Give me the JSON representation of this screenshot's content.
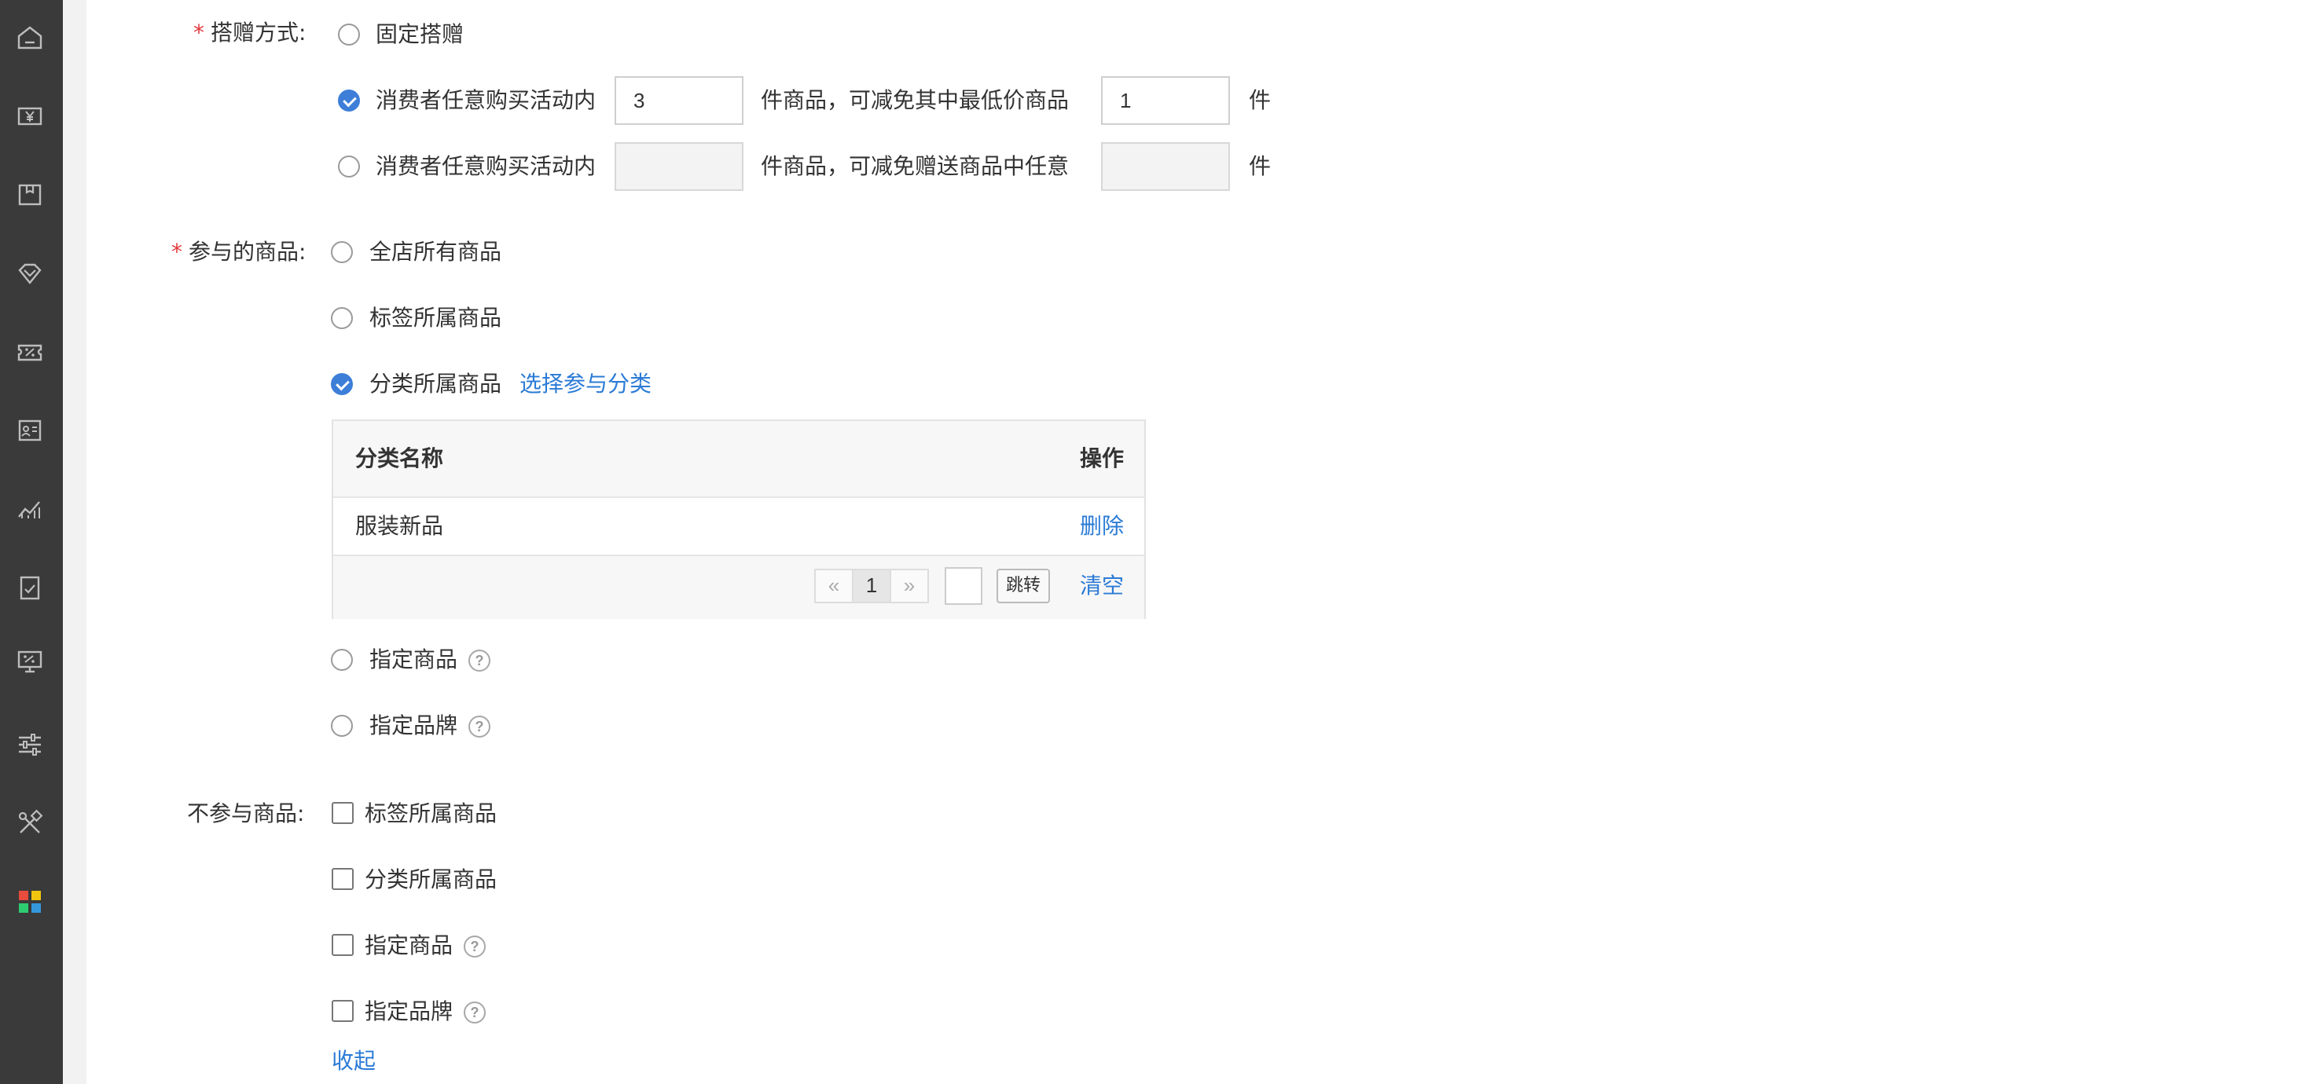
{
  "sidebar": {
    "icons": [
      "home-icon",
      "yen-icon",
      "box-icon",
      "diamond-icon",
      "coupon-icon",
      "member-card-icon",
      "chart-icon",
      "clipboard-icon",
      "monitor-icon",
      "sliders-icon",
      "tools-icon",
      "apps-icon"
    ],
    "apps_colors": [
      "#e74c3c",
      "#f1c40f",
      "#2ecc71",
      "#3498db"
    ]
  },
  "gift_method": {
    "label": "搭赠方式:",
    "option_fixed": "固定搭赠",
    "option_any_prefix": "消费者任意购买活动内",
    "option_any_qty": "3",
    "option_any_mid": "件商品，可减免其中最低价商品",
    "option_any_free": "1",
    "option_any_suffix": "件",
    "option_gift_prefix": "消费者任意购买活动内",
    "option_gift_qty": "",
    "option_gift_mid": "件商品，可减免赠送商品中任意",
    "option_gift_free": "",
    "option_gift_suffix": "件"
  },
  "participating": {
    "label": "参与的商品:",
    "option_all": "全店所有商品",
    "option_tag": "标签所属商品",
    "option_category": "分类所属商品",
    "choose_category_link": "选择参与分类",
    "table": {
      "col_name": "分类名称",
      "col_action": "操作",
      "rows": [
        {
          "name": "服装新品",
          "action": "删除"
        }
      ],
      "pager": {
        "prev": "«",
        "current": "1",
        "next": "»",
        "jump_value": "",
        "jump_label": "跳转",
        "clear": "清空"
      }
    },
    "option_specified": "指定商品",
    "option_brand": "指定品牌",
    "help_glyph": "?"
  },
  "excluded": {
    "label": "不参与商品:",
    "option_tag": "标签所属商品",
    "option_category": "分类所属商品",
    "option_specified": "指定商品",
    "option_brand": "指定品牌",
    "help_glyph": "?",
    "collapse_link": "收起"
  },
  "colors": {
    "accent": "#3d7ed8",
    "link": "#2b7bd6",
    "required": "#e4393c",
    "sidebar": "#3a3a3a"
  }
}
